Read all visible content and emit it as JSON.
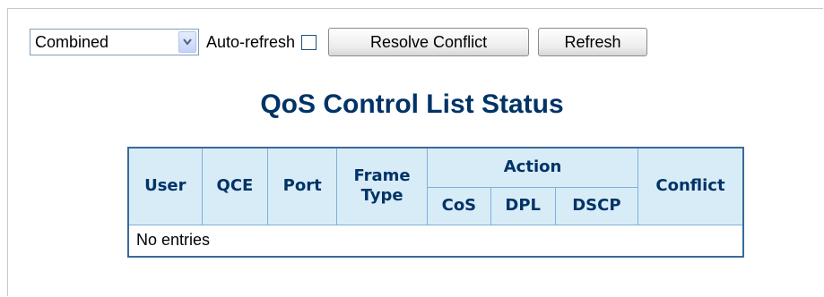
{
  "toolbar": {
    "mode_select": {
      "value": "Combined",
      "arrow_icon": "chevron-down-icon"
    },
    "auto_refresh_label": "Auto-refresh",
    "auto_refresh_checked": false,
    "resolve_button_label": "Resolve Conflict",
    "refresh_button_label": "Refresh"
  },
  "page_title": "QoS Control List Status",
  "table": {
    "headers": {
      "user": "User",
      "qce": "QCE",
      "port": "Port",
      "frame_type": "Frame Type",
      "action": "Action",
      "cos": "CoS",
      "dpl": "DPL",
      "dscp": "DSCP",
      "conflict": "Conflict"
    },
    "empty_message": "No entries"
  },
  "colors": {
    "title": "#003366",
    "header_bg": "#d8ecf8",
    "table_border": "#3a6a98"
  }
}
